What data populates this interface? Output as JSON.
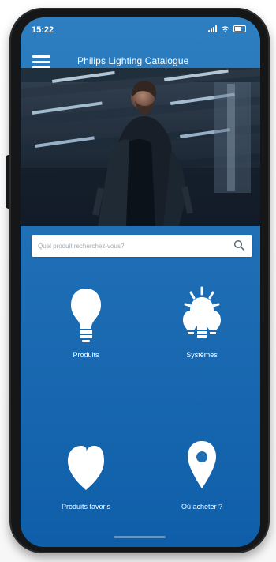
{
  "status_bar": {
    "time": "15:22",
    "signal_icon": "signal-icon",
    "wifi_icon": "wifi-icon",
    "battery_icon": "battery-icon"
  },
  "header": {
    "menu_icon": "hamburger-menu-icon",
    "title": "Philips Lighting Catalogue"
  },
  "hero": {
    "subject": "man-in-dark-jacket-under-ceiling-lights"
  },
  "search": {
    "placeholder": "Quel produit recherchez-vous?",
    "icon": "search-icon"
  },
  "menu_tiles": [
    {
      "label": "Produits",
      "icon": "light-bulb-icon"
    },
    {
      "label": "Systèmes",
      "icon": "smart-lighting-system-icon"
    },
    {
      "label": "Produits favoris",
      "icon": "heart-icon"
    },
    {
      "label": "Où acheter ?",
      "icon": "map-pin-icon"
    }
  ],
  "colors": {
    "screen_blue_top": "#2d7fc1",
    "screen_blue_bottom": "#0f5ea9",
    "white": "#ffffff",
    "phone_frame": "#151617"
  }
}
